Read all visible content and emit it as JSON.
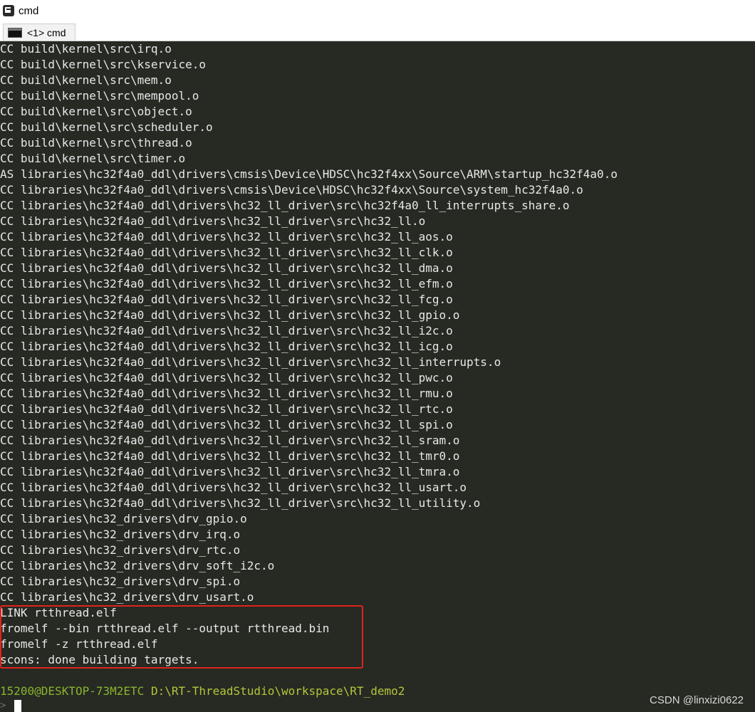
{
  "window": {
    "title": "cmd",
    "icon": "console-app-icon"
  },
  "tabs": [
    {
      "label": "<1> cmd",
      "icon": "terminal-icon"
    }
  ],
  "console": {
    "lines": [
      "CC build\\kernel\\src\\irq.o",
      "CC build\\kernel\\src\\kservice.o",
      "CC build\\kernel\\src\\mem.o",
      "CC build\\kernel\\src\\mempool.o",
      "CC build\\kernel\\src\\object.o",
      "CC build\\kernel\\src\\scheduler.o",
      "CC build\\kernel\\src\\thread.o",
      "CC build\\kernel\\src\\timer.o",
      "AS libraries\\hc32f4a0_ddl\\drivers\\cmsis\\Device\\HDSC\\hc32f4xx\\Source\\ARM\\startup_hc32f4a0.o",
      "CC libraries\\hc32f4a0_ddl\\drivers\\cmsis\\Device\\HDSC\\hc32f4xx\\Source\\system_hc32f4a0.o",
      "CC libraries\\hc32f4a0_ddl\\drivers\\hc32_ll_driver\\src\\hc32f4a0_ll_interrupts_share.o",
      "CC libraries\\hc32f4a0_ddl\\drivers\\hc32_ll_driver\\src\\hc32_ll.o",
      "CC libraries\\hc32f4a0_ddl\\drivers\\hc32_ll_driver\\src\\hc32_ll_aos.o",
      "CC libraries\\hc32f4a0_ddl\\drivers\\hc32_ll_driver\\src\\hc32_ll_clk.o",
      "CC libraries\\hc32f4a0_ddl\\drivers\\hc32_ll_driver\\src\\hc32_ll_dma.o",
      "CC libraries\\hc32f4a0_ddl\\drivers\\hc32_ll_driver\\src\\hc32_ll_efm.o",
      "CC libraries\\hc32f4a0_ddl\\drivers\\hc32_ll_driver\\src\\hc32_ll_fcg.o",
      "CC libraries\\hc32f4a0_ddl\\drivers\\hc32_ll_driver\\src\\hc32_ll_gpio.o",
      "CC libraries\\hc32f4a0_ddl\\drivers\\hc32_ll_driver\\src\\hc32_ll_i2c.o",
      "CC libraries\\hc32f4a0_ddl\\drivers\\hc32_ll_driver\\src\\hc32_ll_icg.o",
      "CC libraries\\hc32f4a0_ddl\\drivers\\hc32_ll_driver\\src\\hc32_ll_interrupts.o",
      "CC libraries\\hc32f4a0_ddl\\drivers\\hc32_ll_driver\\src\\hc32_ll_pwc.o",
      "CC libraries\\hc32f4a0_ddl\\drivers\\hc32_ll_driver\\src\\hc32_ll_rmu.o",
      "CC libraries\\hc32f4a0_ddl\\drivers\\hc32_ll_driver\\src\\hc32_ll_rtc.o",
      "CC libraries\\hc32f4a0_ddl\\drivers\\hc32_ll_driver\\src\\hc32_ll_spi.o",
      "CC libraries\\hc32f4a0_ddl\\drivers\\hc32_ll_driver\\src\\hc32_ll_sram.o",
      "CC libraries\\hc32f4a0_ddl\\drivers\\hc32_ll_driver\\src\\hc32_ll_tmr0.o",
      "CC libraries\\hc32f4a0_ddl\\drivers\\hc32_ll_driver\\src\\hc32_ll_tmra.o",
      "CC libraries\\hc32f4a0_ddl\\drivers\\hc32_ll_driver\\src\\hc32_ll_usart.o",
      "CC libraries\\hc32f4a0_ddl\\drivers\\hc32_ll_driver\\src\\hc32_ll_utility.o",
      "CC libraries\\hc32_drivers\\drv_gpio.o",
      "CC libraries\\hc32_drivers\\drv_irq.o",
      "CC libraries\\hc32_drivers\\drv_rtc.o",
      "CC libraries\\hc32_drivers\\drv_soft_i2c.o",
      "CC libraries\\hc32_drivers\\drv_spi.o",
      "CC libraries\\hc32_drivers\\drv_usart.o",
      "LINK rtthread.elf",
      "fromelf --bin rtthread.elf --output rtthread.bin",
      "fromelf -z rtthread.elf",
      "scons: done building targets."
    ],
    "prompt": {
      "user_host": "15200@DESKTOP-73M2ETC",
      "path": "D:\\RT-ThreadStudio\\workspace\\RT_demo2",
      "input_chevron": ">"
    }
  },
  "watermark": "CSDN @linxizi0622",
  "colors": {
    "console_bg": "#262a23",
    "console_text": "#e8e8e8",
    "prompt_user": "#8ab42c",
    "prompt_path": "#b8c43a",
    "highlight_border": "#e0231c"
  }
}
